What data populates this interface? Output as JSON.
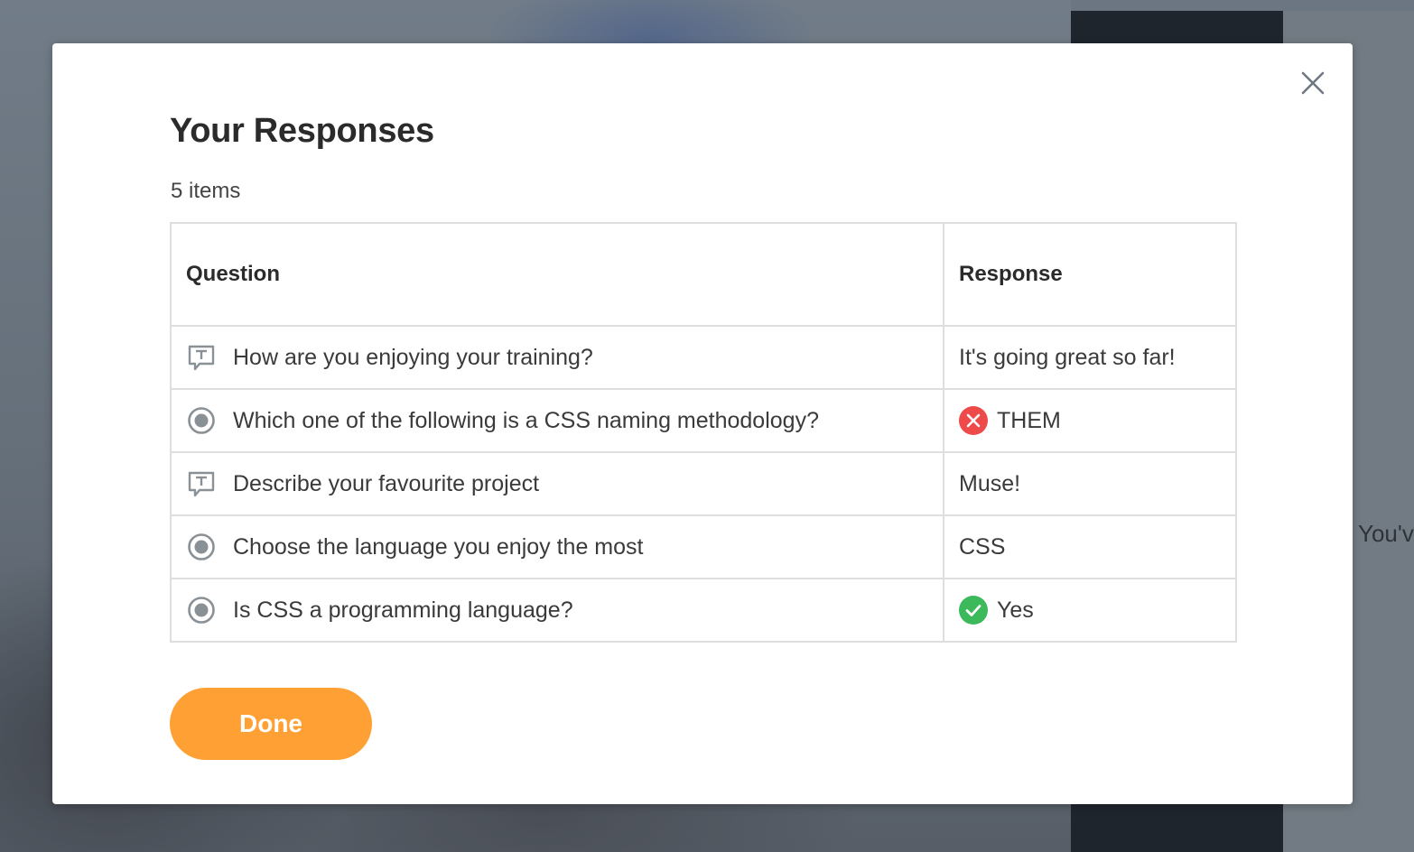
{
  "background": {
    "peek_text": "You'v"
  },
  "modal": {
    "title": "Your Responses",
    "item_count": "5 items",
    "close_icon": "close-icon",
    "table": {
      "headers": [
        "Question",
        "Response"
      ],
      "rows": [
        {
          "question_type": "text-question-icon",
          "question": "How are you enjoying your training?",
          "response": "It's going great so far!",
          "status": null
        },
        {
          "question_type": "radio-question-icon",
          "question": "Which one of the following is a CSS naming methodology?",
          "response": "THEM",
          "status": "incorrect"
        },
        {
          "question_type": "text-question-icon",
          "question": "Describe your favourite project",
          "response": "Muse!",
          "status": null
        },
        {
          "question_type": "radio-question-icon",
          "question": "Choose the language you enjoy the most",
          "response": "CSS",
          "status": null
        },
        {
          "question_type": "radio-question-icon",
          "question": "Is CSS a programming language?",
          "response": "Yes",
          "status": "correct"
        }
      ]
    },
    "done_label": "Done"
  },
  "colors": {
    "accent": "#ffa034",
    "correct": "#3cb95b",
    "incorrect": "#ef4a4a",
    "icon_gray": "#8a9196"
  }
}
